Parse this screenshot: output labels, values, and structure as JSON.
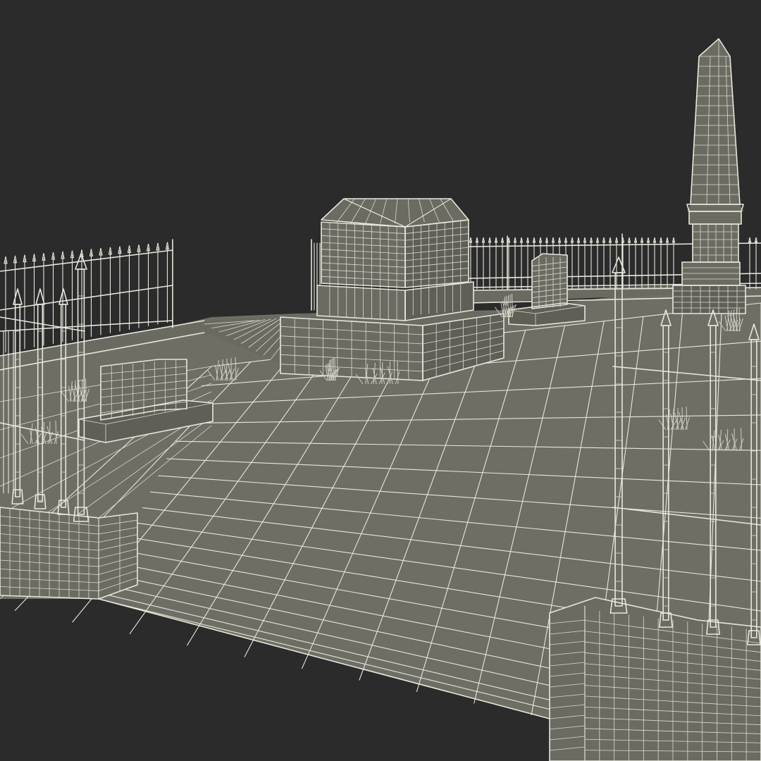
{
  "scene": {
    "background_color": "#2a2b2a",
    "wire_color": "#e9e7dc",
    "surface_color": "#6e6e64",
    "objects": [
      "ground-plane",
      "boundary-wall",
      "iron-fence",
      "tomb-monument",
      "obelisk",
      "headstone-small",
      "headstone-left",
      "gate-post-left",
      "gate-post-right",
      "fence-spikes",
      "grass-tufts"
    ]
  }
}
